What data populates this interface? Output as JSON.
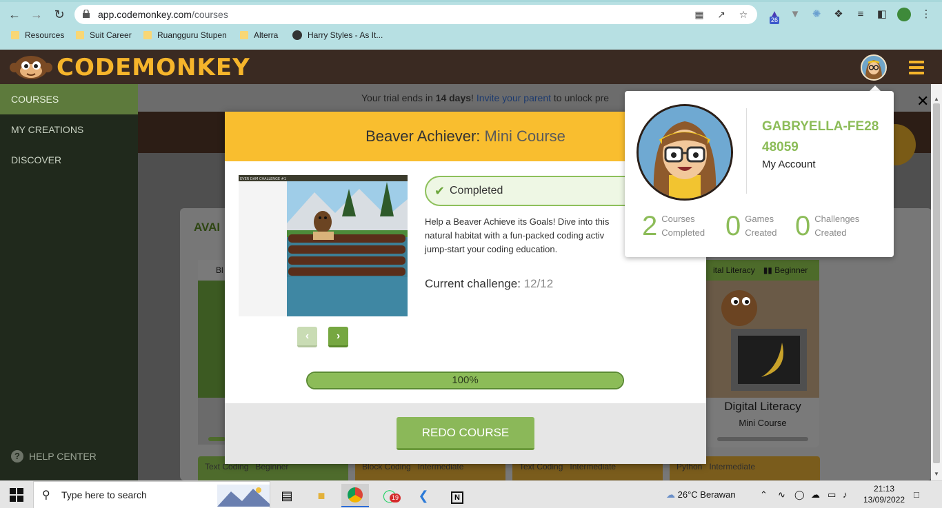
{
  "browser": {
    "url_host": "app.codemonkey.com",
    "url_path": "/courses",
    "bookmarks": [
      "Resources",
      "Suit Career",
      "Ruangguru Stupen",
      "Alterra",
      "Harry Styles - As It..."
    ],
    "extension_badge": "26"
  },
  "header": {
    "logo_text": "CODEMONKEY"
  },
  "sidebar": {
    "items": [
      {
        "label": "COURSES",
        "active": true
      },
      {
        "label": "MY CREATIONS"
      },
      {
        "label": "DISCOVER"
      }
    ],
    "help": "HELP CENTER",
    "help_icon": "?"
  },
  "trial": {
    "prefix": "Your trial ends in ",
    "days": "14 days",
    "exclaim": "!",
    "link": "Invite your parent",
    "suffix": " to unlock pre"
  },
  "courses": {
    "section_title": "AVAI",
    "left_card_tag": "Bl",
    "right_card": {
      "tag": "ital Literacy",
      "level": "Beginner",
      "title": "Digital Literacy",
      "subtitle": "Mini Course"
    },
    "bottom_tags": [
      {
        "type": "Text Coding",
        "level": "Beginner"
      },
      {
        "type": "Block Coding",
        "level": "Intermediate"
      },
      {
        "type": "Text Coding",
        "level": "Intermediate"
      },
      {
        "type": "Python",
        "level": "Intermediate"
      }
    ]
  },
  "modal": {
    "title_main": "Beaver Achiever:",
    "title_sub": " Mini Course",
    "game_title": "EVER DAM CHALLENGE #1",
    "status": "Completed",
    "description": "Help a Beaver Achieve its Goals! Dive into this\nnatural habitat with a fun-packed coding activ\njump-start your coding education.",
    "challenge_label": "Current challenge:",
    "challenge_value": "12/12",
    "progress_percent": 100,
    "progress_label": "100%",
    "redo_label": "REDO COURSE"
  },
  "account": {
    "name": "GABRYELLA-FE2848059",
    "link": "My Account",
    "stats": [
      {
        "value": "2",
        "label": "Courses\nCompleted"
      },
      {
        "value": "0",
        "label": "Games\nCreated"
      },
      {
        "value": "0",
        "label": "Challenges\nCreated"
      }
    ],
    "close": "✕"
  },
  "taskbar": {
    "search_placeholder": "Type here to search",
    "weather": "26°C  Berawan",
    "time": "21:13",
    "date": "13/09/2022",
    "whatsapp_badge": "19"
  },
  "colors": {
    "accent_green": "#8cbc58",
    "header_yellow": "#f9be2f",
    "brand_brown": "#3a2a22"
  }
}
